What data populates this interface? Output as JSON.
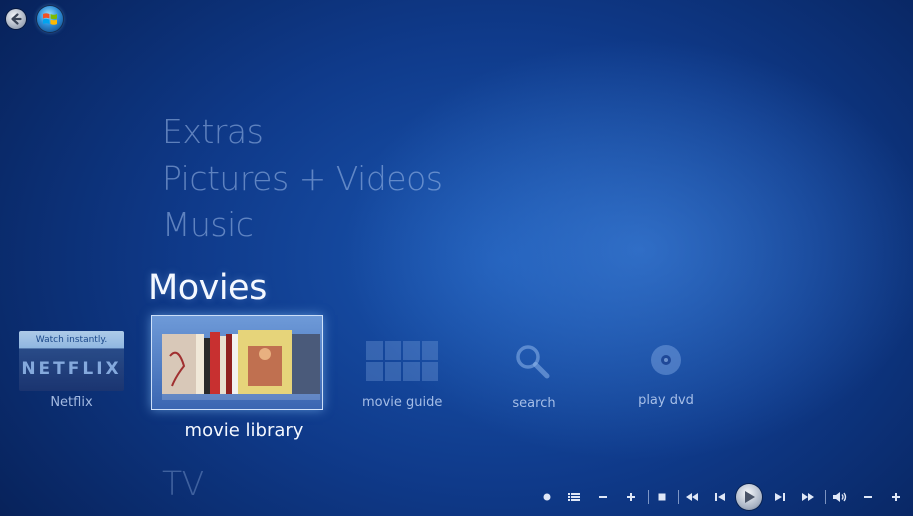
{
  "menu": {
    "extras": "Extras",
    "pictures_videos": "Pictures + Videos",
    "music": "Music",
    "movies": "Movies",
    "tv": "TV"
  },
  "strip": {
    "netflix": {
      "tile_top": "Watch instantly.",
      "logo": "NETFLIX",
      "label": "Netflix"
    },
    "movie_library": {
      "label": "movie library"
    },
    "movie_guide": {
      "label": "movie guide"
    },
    "search": {
      "label": "search"
    },
    "play_dvd": {
      "label": "play dvd"
    }
  },
  "icons": {
    "back": "back-arrow-icon",
    "start": "windows-orb-icon",
    "record": "record-icon",
    "details": "details-list-icon",
    "channel_down": "minus-icon",
    "channel_up": "plus-icon",
    "stop": "stop-icon",
    "rewind": "rewind-icon",
    "previous": "skip-back-icon",
    "play": "play-icon",
    "next": "skip-forward-icon",
    "fast_forward": "fast-forward-icon",
    "mute": "speaker-icon",
    "volume_down": "minus-icon",
    "volume_up": "plus-icon"
  },
  "colors": {
    "background": "#0f3a8a",
    "focus_text": "#f4f8ff",
    "dim_text": "#a0bee8"
  }
}
